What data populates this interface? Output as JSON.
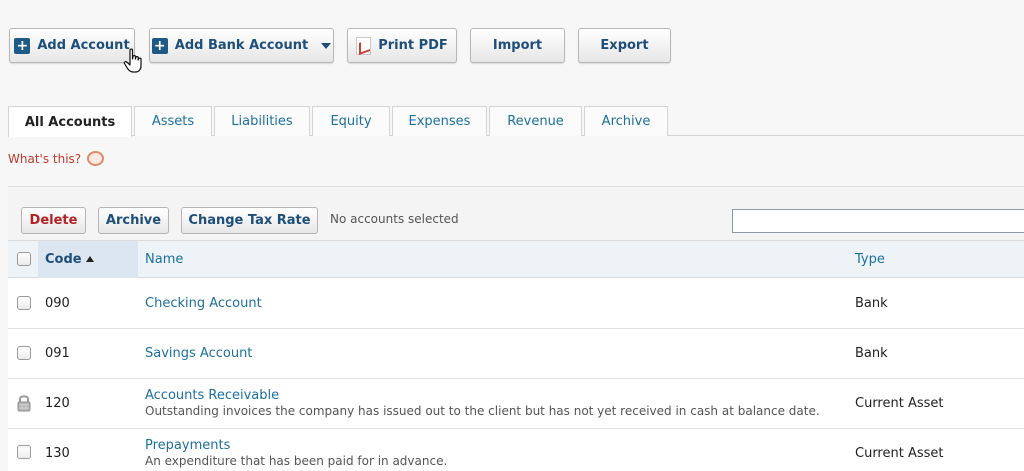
{
  "toolbar": {
    "add_account": "Add Account",
    "add_bank_account": "Add Bank Account",
    "print_pdf": "Print PDF",
    "import": "Import",
    "export": "Export"
  },
  "tabs": [
    {
      "label": "All Accounts",
      "active": true
    },
    {
      "label": "Assets"
    },
    {
      "label": "Liabilities"
    },
    {
      "label": "Equity"
    },
    {
      "label": "Expenses"
    },
    {
      "label": "Revenue"
    },
    {
      "label": "Archive"
    }
  ],
  "help": {
    "whats_this": "What's this?"
  },
  "actions": {
    "delete": "Delete",
    "archive": "Archive",
    "change_tax_rate": "Change Tax Rate",
    "selection_status": "No accounts selected",
    "search_value": ""
  },
  "table": {
    "headers": {
      "code": "Code",
      "name": "Name",
      "type": "Type"
    },
    "rows": [
      {
        "code": "090",
        "name": "Checking Account",
        "description": "",
        "type": "Bank",
        "locked": false
      },
      {
        "code": "091",
        "name": "Savings Account",
        "description": "",
        "type": "Bank",
        "locked": false
      },
      {
        "code": "120",
        "name": "Accounts Receivable",
        "description": "Outstanding invoices the company has issued out to the client but has not yet received in cash at balance date.",
        "type": "Current Asset",
        "locked": true
      },
      {
        "code": "130",
        "name": "Prepayments",
        "description": "An expenditure that has been paid for in advance.",
        "type": "Current Asset",
        "locked": false
      }
    ]
  },
  "colors": {
    "link": "#1d6fa0",
    "button_text": "#1e4f7a",
    "delete": "#b22222",
    "help_text": "#c0392b"
  }
}
